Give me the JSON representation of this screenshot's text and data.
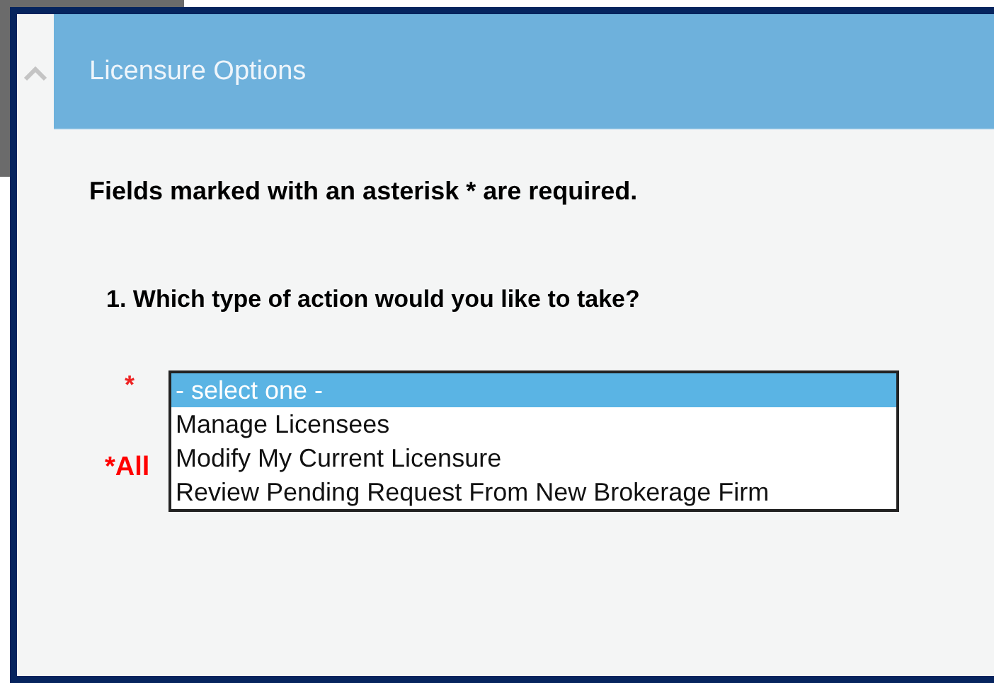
{
  "panel": {
    "title": "Licensure Options"
  },
  "required_note": "Fields marked with an asterisk * are required.",
  "question": "1. Which type of action would you like to take?",
  "required_mark": "*",
  "dropdown": {
    "options": [
      {
        "label": "- select one -",
        "selected": true
      },
      {
        "label": "Manage Licensees",
        "selected": false
      },
      {
        "label": "Modify My Current Licensure",
        "selected": false
      },
      {
        "label": "Review Pending Request From New Brokerage Firm",
        "selected": false
      }
    ]
  },
  "error_note": "*All"
}
